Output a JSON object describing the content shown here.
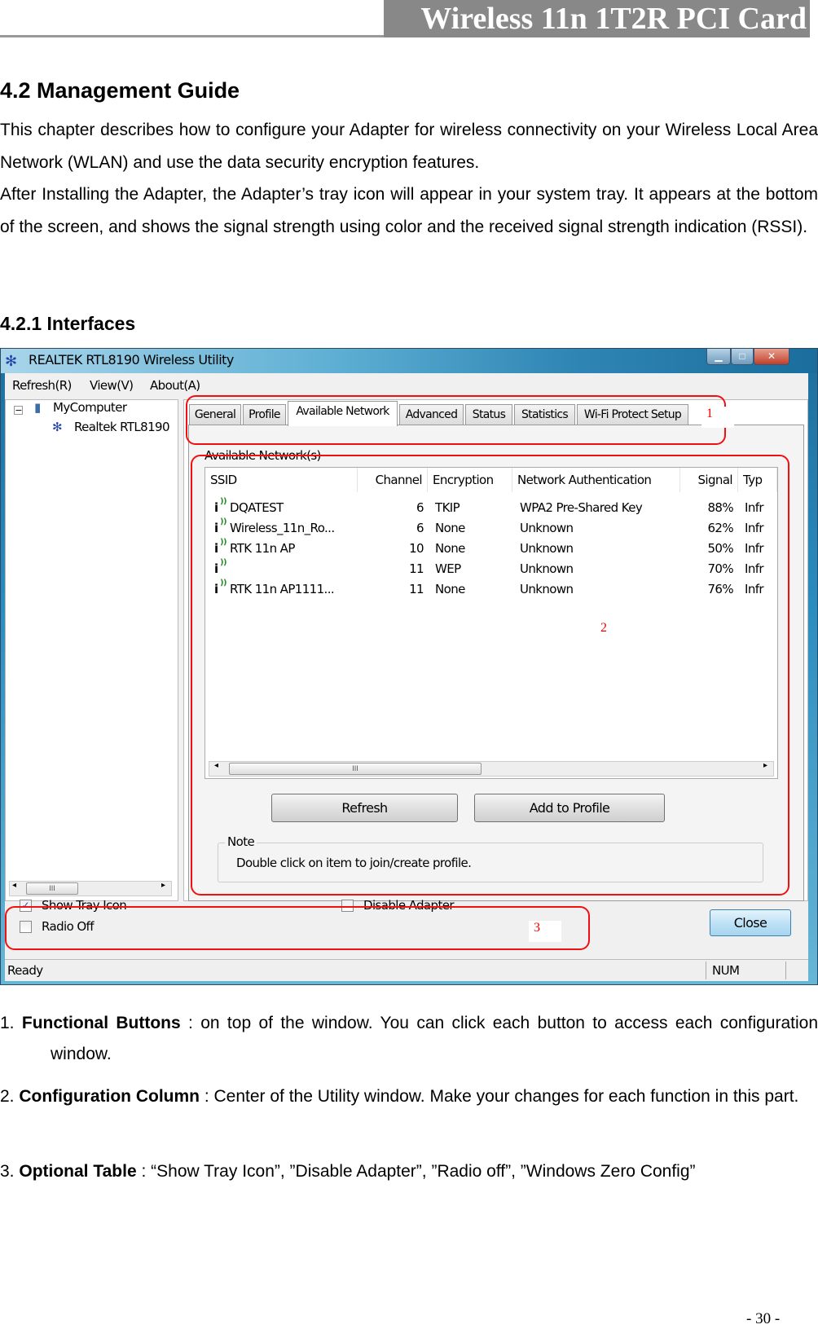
{
  "header": {
    "title": "Wireless 11n 1T2R PCI Card"
  },
  "section": {
    "heading": "4.2 Management Guide",
    "paragraph1": "This chapter describes how to configure your Adapter for wireless connectivity on your Wireless Local Area Network (WLAN) and use the data security encryption features.",
    "paragraph2": "After Installing the Adapter, the Adapter’s tray icon will appear in your system tray. It appears at the bottom of the screen, and shows the signal strength using color and the received signal strength indication (RSSI).",
    "subheading": "4.2.1 Interfaces"
  },
  "window": {
    "title": "REALTEK RTL8190 Wireless Utility",
    "menu": [
      "Refresh(R)",
      "View(V)",
      "About(A)"
    ],
    "tree": {
      "root": "MyComputer",
      "child": "Realtek RTL8190"
    },
    "tabs": [
      "General",
      "Profile",
      "Available Network",
      "Advanced",
      "Status",
      "Statistics",
      "Wi-Fi Protect Setup"
    ],
    "active_tab": "Available Network",
    "group_label": "Available Network(s)",
    "columns": [
      "SSID",
      "Channel",
      "Encryption",
      "Network Authentication",
      "Signal",
      "Typ"
    ],
    "networks": [
      {
        "ssid": "DQATEST",
        "channel": "6",
        "encryption": "TKIP",
        "auth": "WPA2 Pre-Shared Key",
        "signal": "88%",
        "type": "Infr"
      },
      {
        "ssid": "Wireless_11n_Ro...",
        "channel": "6",
        "encryption": "None",
        "auth": "Unknown",
        "signal": "62%",
        "type": "Infr"
      },
      {
        "ssid": "RTK 11n AP",
        "channel": "10",
        "encryption": "None",
        "auth": "Unknown",
        "signal": "50%",
        "type": "Infr"
      },
      {
        "ssid": "",
        "channel": "11",
        "encryption": "WEP",
        "auth": "Unknown",
        "signal": "70%",
        "type": "Infr"
      },
      {
        "ssid": "RTK 11n AP1111...",
        "channel": "11",
        "encryption": "None",
        "auth": "Unknown",
        "signal": "76%",
        "type": "Infr"
      }
    ],
    "refresh_button": "Refresh",
    "add_profile_button": "Add to Profile",
    "note_label": "Note",
    "note_text": "Double click on item to join/create profile.",
    "show_tray_icon": {
      "label": "Show Tray Icon",
      "checked": true
    },
    "radio_off": {
      "label": "Radio Off",
      "checked": false
    },
    "disable_adapter": {
      "label": "Disable Adapter",
      "checked": false
    },
    "close_button": "Close",
    "status_left": "Ready",
    "status_num": "NUM",
    "callouts": [
      "1",
      "2",
      "3"
    ],
    "scroll_grip": "III"
  },
  "list": [
    {
      "num": "1.",
      "term": "Functional Buttons",
      "text": " : on top of the window. You can click each button to access each configuration window."
    },
    {
      "num": "2.",
      "term": "Configuration Column",
      "text": " : Center of the Utility window. Make your changes for each function in this part."
    },
    {
      "num": "3.",
      "term": "Optional Table",
      "text": " : “Show Tray Icon”, ”Disable Adapter”, ”Radio off”, ”Windows Zero Config”"
    }
  ],
  "page_number": "- 30 -",
  "colors": {
    "callout_red": "#f01010",
    "title_band": "#888888",
    "window_frame": "#2b8cbf"
  }
}
